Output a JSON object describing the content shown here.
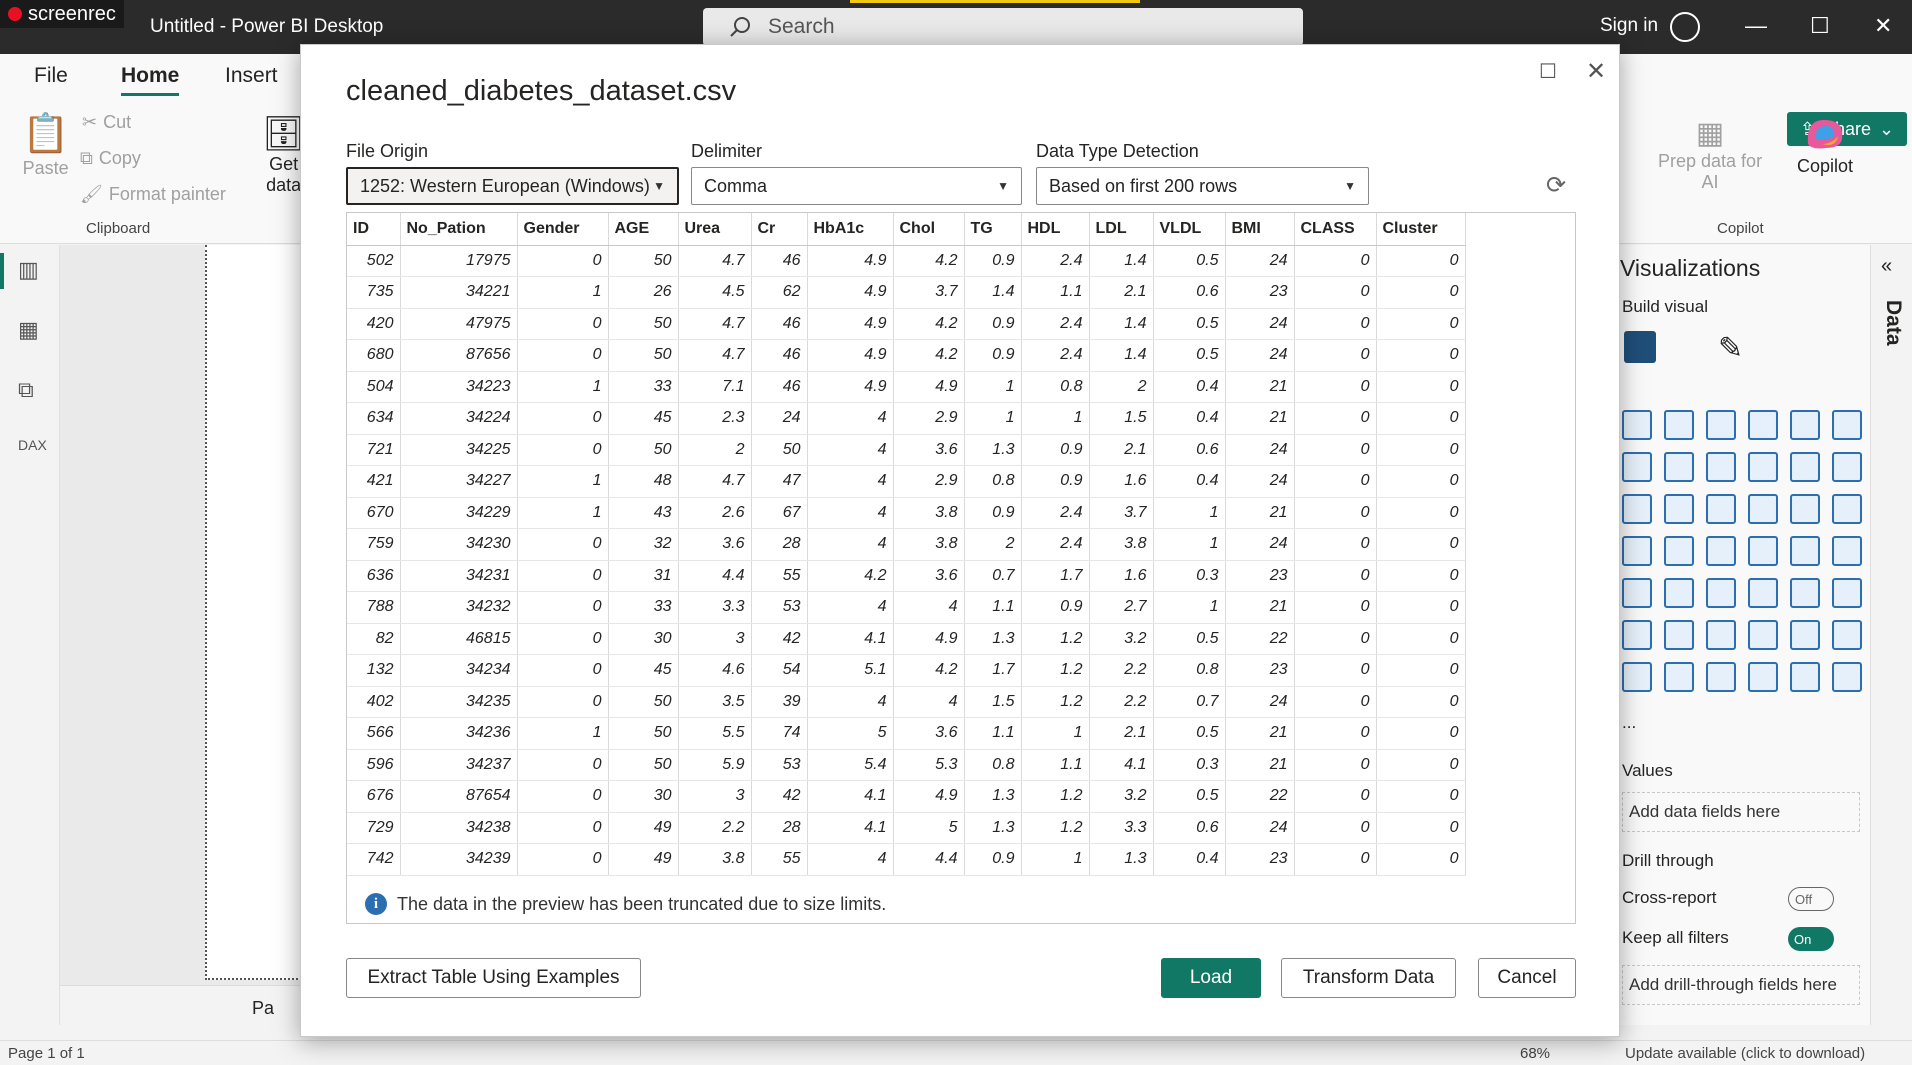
{
  "recorder": {
    "label": "screenrec"
  },
  "window": {
    "title": "Untitled - Power BI Desktop",
    "search_placeholder": "Search",
    "sign_in": "Sign in"
  },
  "ribbon": {
    "tabs": [
      "File",
      "Home",
      "Insert"
    ],
    "clipboard": {
      "paste": "Paste",
      "cut": "Cut",
      "copy": "Copy",
      "format_painter": "Format painter",
      "group": "Clipboard"
    },
    "get_data": {
      "line1": "Get",
      "line2": "data"
    },
    "prep_data": {
      "line1": "Prep data for",
      "line2": "AI"
    },
    "copilot": {
      "label": "Copilot",
      "group": "Copilot"
    },
    "share": "Share"
  },
  "visualizations": {
    "title": "Visualizations",
    "build_visual": "Build visual",
    "values": "Values",
    "add_data_fields": "Add data fields here",
    "drill_through": "Drill through",
    "cross_report": "Cross-report",
    "cross_report_state": "Off",
    "keep_all_filters": "Keep all filters",
    "keep_all_filters_state": "On",
    "add_drill_fields": "Add drill-through fields here",
    "more": "..."
  },
  "data_pane": {
    "label": "Data"
  },
  "status": {
    "page": "Page 1 of 1",
    "zoom": "68%",
    "update": "Update available (click to download)"
  },
  "page_tab": {
    "label": "Pa"
  },
  "dialog": {
    "title": "cleaned_diabetes_dataset.csv",
    "file_origin": {
      "label": "File Origin",
      "value": "1252: Western European (Windows)"
    },
    "delimiter": {
      "label": "Delimiter",
      "value": "Comma"
    },
    "detection": {
      "label": "Data Type Detection",
      "value": "Based on first 200 rows"
    },
    "columns": [
      "ID",
      "No_Pation",
      "Gender",
      "AGE",
      "Urea",
      "Cr",
      "HbA1c",
      "Chol",
      "TG",
      "HDL",
      "LDL",
      "VLDL",
      "BMI",
      "CLASS",
      "Cluster"
    ],
    "rows": [
      [
        "502",
        "17975",
        "0",
        "50",
        "4.7",
        "46",
        "4.9",
        "4.2",
        "0.9",
        "2.4",
        "1.4",
        "0.5",
        "24",
        "0",
        "0"
      ],
      [
        "735",
        "34221",
        "1",
        "26",
        "4.5",
        "62",
        "4.9",
        "3.7",
        "1.4",
        "1.1",
        "2.1",
        "0.6",
        "23",
        "0",
        "0"
      ],
      [
        "420",
        "47975",
        "0",
        "50",
        "4.7",
        "46",
        "4.9",
        "4.2",
        "0.9",
        "2.4",
        "1.4",
        "0.5",
        "24",
        "0",
        "0"
      ],
      [
        "680",
        "87656",
        "0",
        "50",
        "4.7",
        "46",
        "4.9",
        "4.2",
        "0.9",
        "2.4",
        "1.4",
        "0.5",
        "24",
        "0",
        "0"
      ],
      [
        "504",
        "34223",
        "1",
        "33",
        "7.1",
        "46",
        "4.9",
        "4.9",
        "1",
        "0.8",
        "2",
        "0.4",
        "21",
        "0",
        "0"
      ],
      [
        "634",
        "34224",
        "0",
        "45",
        "2.3",
        "24",
        "4",
        "2.9",
        "1",
        "1",
        "1.5",
        "0.4",
        "21",
        "0",
        "0"
      ],
      [
        "721",
        "34225",
        "0",
        "50",
        "2",
        "50",
        "4",
        "3.6",
        "1.3",
        "0.9",
        "2.1",
        "0.6",
        "24",
        "0",
        "0"
      ],
      [
        "421",
        "34227",
        "1",
        "48",
        "4.7",
        "47",
        "4",
        "2.9",
        "0.8",
        "0.9",
        "1.6",
        "0.4",
        "24",
        "0",
        "0"
      ],
      [
        "670",
        "34229",
        "1",
        "43",
        "2.6",
        "67",
        "4",
        "3.8",
        "0.9",
        "2.4",
        "3.7",
        "1",
        "21",
        "0",
        "0"
      ],
      [
        "759",
        "34230",
        "0",
        "32",
        "3.6",
        "28",
        "4",
        "3.8",
        "2",
        "2.4",
        "3.8",
        "1",
        "24",
        "0",
        "0"
      ],
      [
        "636",
        "34231",
        "0",
        "31",
        "4.4",
        "55",
        "4.2",
        "3.6",
        "0.7",
        "1.7",
        "1.6",
        "0.3",
        "23",
        "0",
        "0"
      ],
      [
        "788",
        "34232",
        "0",
        "33",
        "3.3",
        "53",
        "4",
        "4",
        "1.1",
        "0.9",
        "2.7",
        "1",
        "21",
        "0",
        "0"
      ],
      [
        "82",
        "46815",
        "0",
        "30",
        "3",
        "42",
        "4.1",
        "4.9",
        "1.3",
        "1.2",
        "3.2",
        "0.5",
        "22",
        "0",
        "0"
      ],
      [
        "132",
        "34234",
        "0",
        "45",
        "4.6",
        "54",
        "5.1",
        "4.2",
        "1.7",
        "1.2",
        "2.2",
        "0.8",
        "23",
        "0",
        "0"
      ],
      [
        "402",
        "34235",
        "0",
        "50",
        "3.5",
        "39",
        "4",
        "4",
        "1.5",
        "1.2",
        "2.2",
        "0.7",
        "24",
        "0",
        "0"
      ],
      [
        "566",
        "34236",
        "1",
        "50",
        "5.5",
        "74",
        "5",
        "3.6",
        "1.1",
        "1",
        "2.1",
        "0.5",
        "21",
        "0",
        "0"
      ],
      [
        "596",
        "34237",
        "0",
        "50",
        "5.9",
        "53",
        "5.4",
        "5.3",
        "0.8",
        "1.1",
        "4.1",
        "0.3",
        "21",
        "0",
        "0"
      ],
      [
        "676",
        "87654",
        "0",
        "30",
        "3",
        "42",
        "4.1",
        "4.9",
        "1.3",
        "1.2",
        "3.2",
        "0.5",
        "22",
        "0",
        "0"
      ],
      [
        "729",
        "34238",
        "0",
        "49",
        "2.2",
        "28",
        "4.1",
        "5",
        "1.3",
        "1.2",
        "3.3",
        "0.6",
        "24",
        "0",
        "0"
      ],
      [
        "742",
        "34239",
        "0",
        "49",
        "3.8",
        "55",
        "4",
        "4.4",
        "0.9",
        "1",
        "1.3",
        "0.4",
        "23",
        "0",
        "0"
      ]
    ],
    "truncated_notice": "The data in the preview has been truncated due to size limits.",
    "buttons": {
      "extract": "Extract Table Using Examples",
      "load": "Load",
      "transform": "Transform Data",
      "cancel": "Cancel"
    }
  },
  "colors": {
    "accent": "#117865",
    "titlebar": "#2b2b2b",
    "info": "#2c6fb0"
  }
}
